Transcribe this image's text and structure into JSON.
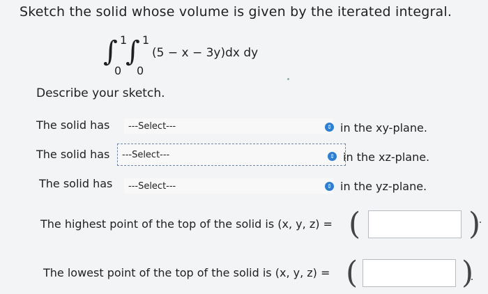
{
  "heading": "Sketch the solid whose volume is given by the iterated integral.",
  "integral": {
    "outer_upper": "1",
    "outer_lower": "0",
    "inner_upper": "1",
    "inner_lower": "0",
    "integrand": "(5 − x − 3y)dx dy"
  },
  "describe_label": "Describe your sketch.",
  "rows": [
    {
      "label": "The solid has",
      "select_value": "---Select---",
      "plane": "in the xy-plane."
    },
    {
      "label": "The solid has",
      "select_value": "---Select---",
      "plane": "in the xz-plane."
    },
    {
      "label": "The solid has",
      "select_value": "---Select---",
      "plane": "in the yz-plane."
    }
  ],
  "highest": {
    "label": "The highest point of the top of the solid is (x, y, z) =",
    "value": ""
  },
  "lowest": {
    "label": "The lowest point of the top of the solid is (x, y, z) =",
    "value": ""
  },
  "colors": {
    "select_icon": "#2f7fd0",
    "focus_border": "#6b86a8",
    "background": "#f3f4f6"
  }
}
